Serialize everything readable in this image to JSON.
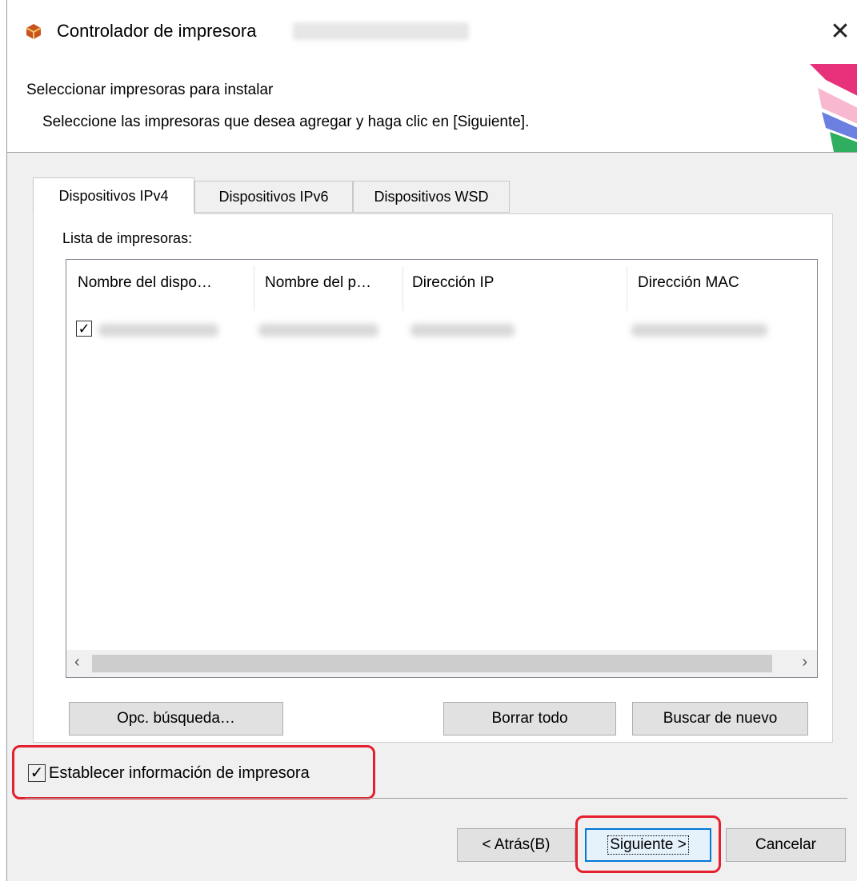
{
  "window": {
    "title": "Controlador de impresora",
    "close_glyph": "✕",
    "app_icon": "package-icon"
  },
  "header": {
    "title": "Seleccionar impresoras para instalar",
    "subtitle": "Seleccione las impresoras que desea agregar y haga clic en [Siguiente]."
  },
  "tabs": [
    {
      "label": "Dispositivos IPv4",
      "active": true
    },
    {
      "label": "Dispositivos IPv6",
      "active": false
    },
    {
      "label": "Dispositivos WSD",
      "active": false
    }
  ],
  "list": {
    "label": "Lista de impresoras:",
    "columns": [
      "Nombre del dispo…",
      "Nombre del p…",
      "Dirección IP",
      "Dirección MAC"
    ],
    "rows": [
      {
        "checked": true
      }
    ]
  },
  "scroll": {
    "left_glyph": "‹",
    "right_glyph": "›"
  },
  "buttons": {
    "search_options": "Opc. búsqueda…",
    "clear_all": "Borrar todo",
    "search_again": "Buscar de nuevo",
    "back": "< Atrás(B)",
    "next": "Siguiente >",
    "cancel": "Cancelar"
  },
  "set_printer_info": {
    "label": "Establecer información de impresora",
    "checked": true
  },
  "check_glyph": "✓",
  "colors": {
    "highlight": "#e4202e",
    "accent": "#0078d7"
  }
}
